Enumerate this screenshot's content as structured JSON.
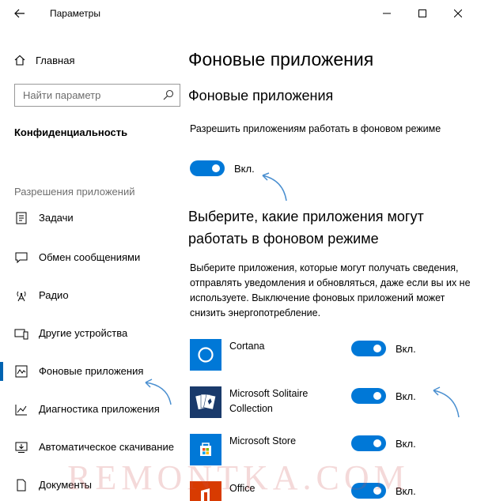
{
  "window": {
    "title": "Параметры",
    "accent": "#0078d7"
  },
  "sidebar": {
    "home_label": "Главная",
    "search_placeholder": "Найти параметр",
    "section_title": "Конфиденциальность",
    "group_label": "Разрешения приложений",
    "items": [
      {
        "label": "Задачи",
        "icon": "tasks-icon"
      },
      {
        "label": "Обмен сообщениями",
        "icon": "messaging-icon"
      },
      {
        "label": "Радио",
        "icon": "radio-icon"
      },
      {
        "label": "Другие устройства",
        "icon": "devices-icon"
      },
      {
        "label": "Фоновые приложения",
        "icon": "background-apps-icon",
        "active": true
      },
      {
        "label": "Диагностика приложения",
        "icon": "diagnostics-icon"
      },
      {
        "label": "Автоматическое скачивание",
        "icon": "download-icon"
      },
      {
        "label": "Документы",
        "icon": "documents-icon"
      }
    ]
  },
  "main": {
    "page_title": "Фоновые приложения",
    "sub_title": "Фоновые приложения",
    "allow_desc": "Разрешить приложениям работать в фоновом режиме",
    "allow_toggle_label": "Вкл.",
    "choose_title": "Выберите, какие приложения могут работать в фоновом режиме",
    "choose_desc": "Выберите приложения, которые могут получать сведения, отправлять уведомления и обновляться, даже если вы их не используете. Выключение фоновых приложений может снизить энергопотребление.",
    "apps": [
      {
        "name": "Cortana",
        "toggle_label": "Вкл.",
        "icon": "cortana-icon"
      },
      {
        "name": "Microsoft Solitaire Collection",
        "toggle_label": "Вкл.",
        "icon": "solitaire-icon"
      },
      {
        "name": "Microsoft Store",
        "toggle_label": "Вкл.",
        "icon": "store-icon"
      },
      {
        "name": "Office",
        "toggle_label": "Вкл.",
        "icon": "office-icon"
      }
    ]
  },
  "watermark": "REMONTKA.COM"
}
